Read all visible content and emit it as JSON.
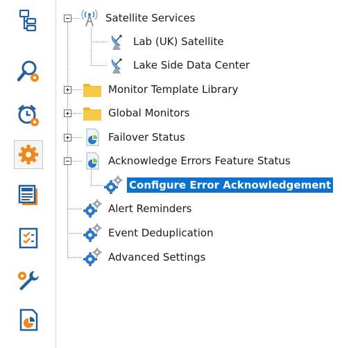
{
  "toolbar": {
    "items": [
      {
        "icon": "tree-view-icon"
      },
      {
        "icon": "search-settings-icon"
      },
      {
        "icon": "alarm-clock-settings-icon"
      },
      {
        "icon": "settings-gear-icon",
        "selected": true
      },
      {
        "icon": "news-icon"
      },
      {
        "icon": "checklist-icon"
      },
      {
        "icon": "tools-icon"
      },
      {
        "icon": "report-chart-icon"
      }
    ]
  },
  "tree": {
    "satellite_services": "Satellite Services",
    "lab_uk_satellite": "Lab (UK) Satellite",
    "lake_side_data_center": "Lake Side Data Center",
    "monitor_template_library": "Monitor Template Library",
    "global_monitors": "Global Monitors",
    "failover_status": "Failover Status",
    "acknowledge_errors_feature_status": "Acknowledge Errors Feature Status",
    "configure_error_acknowledgement": "Configure Error Acknowledgement",
    "alert_reminders": "Alert Reminders",
    "event_deduplication": "Event Deduplication",
    "advanced_settings": "Advanced Settings"
  },
  "colors": {
    "selection": "#0a73d1",
    "folder": "#f7c94a",
    "gear_blue": "#2b78c8",
    "toolbar_orange": "#f0891a",
    "toolbar_blue": "#1f5f9e"
  }
}
